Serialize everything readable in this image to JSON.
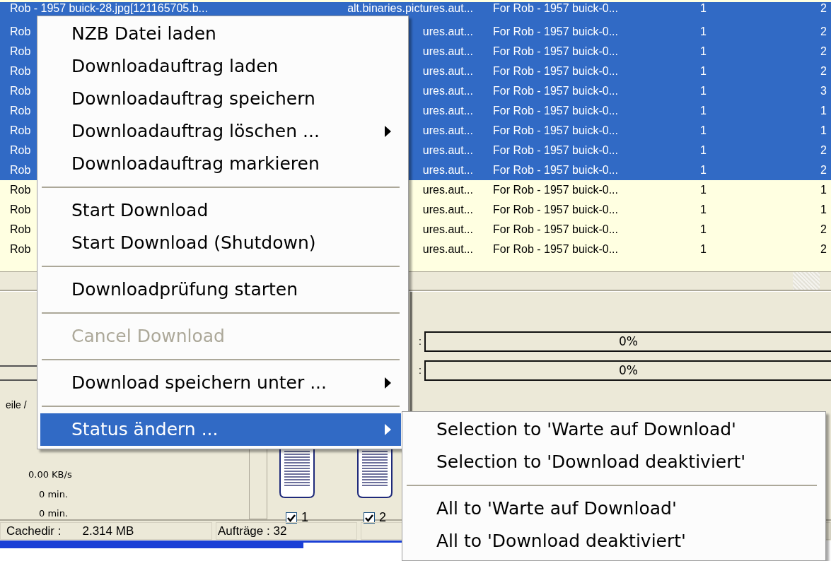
{
  "table": {
    "rows": [
      {
        "selected": true,
        "cells": [
          "Rob - 1957 buick-28.jpg[121165705.b...",
          "alt.binaries.pictures.aut...",
          "For Rob - 1957 buick-0...",
          "1",
          "2"
        ]
      },
      {
        "selected": true,
        "cells": [
          "Rob",
          "ures.aut...",
          "For Rob - 1957 buick-0...",
          "1",
          "2"
        ]
      },
      {
        "selected": true,
        "cells": [
          "Rob",
          "ures.aut...",
          "For Rob - 1957 buick-0...",
          "1",
          "2"
        ]
      },
      {
        "selected": true,
        "cells": [
          "Rob",
          "ures.aut...",
          "For Rob - 1957 buick-0...",
          "1",
          "2"
        ]
      },
      {
        "selected": true,
        "cells": [
          "Rob",
          "ures.aut...",
          "For Rob - 1957 buick-0...",
          "1",
          "3"
        ]
      },
      {
        "selected": true,
        "cells": [
          "Rob",
          "ures.aut...",
          "For Rob - 1957 buick-0...",
          "1",
          "1"
        ]
      },
      {
        "selected": true,
        "cells": [
          "Rob",
          "ures.aut...",
          "For Rob - 1957 buick-0...",
          "1",
          "1"
        ]
      },
      {
        "selected": true,
        "cells": [
          "Rob",
          "ures.aut...",
          "For Rob - 1957 buick-0...",
          "1",
          "2"
        ]
      },
      {
        "selected": true,
        "cells": [
          "Rob",
          "ures.aut...",
          "For Rob - 1957 buick-0...",
          "1",
          "2"
        ]
      },
      {
        "selected": false,
        "cells": [
          "Rob",
          "ures.aut...",
          "For Rob - 1957 buick-0...",
          "1",
          "1"
        ]
      },
      {
        "selected": false,
        "cells": [
          "Rob",
          "ures.aut...",
          "For Rob - 1957 buick-0...",
          "1",
          "1"
        ]
      },
      {
        "selected": false,
        "cells": [
          "Rob",
          "ures.aut...",
          "For Rob - 1957 buick-0...",
          "1",
          "2"
        ]
      },
      {
        "selected": false,
        "cells": [
          "Rob",
          "ures.aut...",
          "For Rob - 1957 buick-0...",
          "1",
          "2"
        ]
      }
    ]
  },
  "left_panel": {
    "caption": "eile /",
    "stats": [
      "0.00 KB/s",
      "0 min.",
      "0 min."
    ]
  },
  "slots": [
    {
      "label": "1",
      "checked": true
    },
    {
      "label": "2",
      "checked": true
    }
  ],
  "progress_bars": [
    {
      "label": ":",
      "text": "0%",
      "level": 0
    },
    {
      "label": ":",
      "text": "0%",
      "level": 0
    }
  ],
  "status_bar": {
    "panels": [
      {
        "texts": [
          "Cachedir :",
          "2.314 MB"
        ]
      },
      {
        "texts": [
          "Aufträge : 32"
        ]
      }
    ]
  },
  "bottom_progress": {
    "level": 0.755
  },
  "context_menu": {
    "items": [
      {
        "kind": "item",
        "label": "NZB Datei laden",
        "submenu": false,
        "disabled": false,
        "selected": false
      },
      {
        "kind": "item",
        "label": "Downloadauftrag laden",
        "submenu": false,
        "disabled": false,
        "selected": false
      },
      {
        "kind": "item",
        "label": "Downloadauftrag speichern",
        "submenu": false,
        "disabled": false,
        "selected": false
      },
      {
        "kind": "item",
        "label": "Downloadauftrag löschen ...",
        "submenu": true,
        "disabled": false,
        "selected": false
      },
      {
        "kind": "item",
        "label": "Downloadauftrag markieren",
        "submenu": false,
        "disabled": false,
        "selected": false
      },
      {
        "kind": "separator"
      },
      {
        "kind": "item",
        "label": "Start Download",
        "submenu": false,
        "disabled": false,
        "selected": false
      },
      {
        "kind": "item",
        "label": "Start Download (Shutdown)",
        "submenu": false,
        "disabled": false,
        "selected": false
      },
      {
        "kind": "separator"
      },
      {
        "kind": "item",
        "label": "Downloadprüfung starten",
        "submenu": false,
        "disabled": false,
        "selected": false
      },
      {
        "kind": "separator"
      },
      {
        "kind": "item",
        "label": "Cancel Download",
        "submenu": false,
        "disabled": true,
        "selected": false
      },
      {
        "kind": "separator"
      },
      {
        "kind": "item",
        "label": "Download speichern unter ...",
        "submenu": true,
        "disabled": false,
        "selected": false
      },
      {
        "kind": "separator"
      },
      {
        "kind": "item",
        "label": "Status ändern ...",
        "submenu": true,
        "disabled": false,
        "selected": true
      }
    ]
  },
  "submenu": {
    "items": [
      {
        "kind": "item",
        "label": "Selection to 'Warte auf Download'",
        "submenu": false,
        "disabled": false,
        "selected": false
      },
      {
        "kind": "item",
        "label": "Selection to 'Download deaktiviert'",
        "submenu": false,
        "disabled": false,
        "selected": false
      },
      {
        "kind": "separator"
      },
      {
        "kind": "item",
        "label": "All to 'Warte auf Download'",
        "submenu": false,
        "disabled": false,
        "selected": false
      },
      {
        "kind": "item",
        "label": "All to 'Download deaktiviert'",
        "submenu": false,
        "disabled": false,
        "selected": false
      }
    ]
  }
}
